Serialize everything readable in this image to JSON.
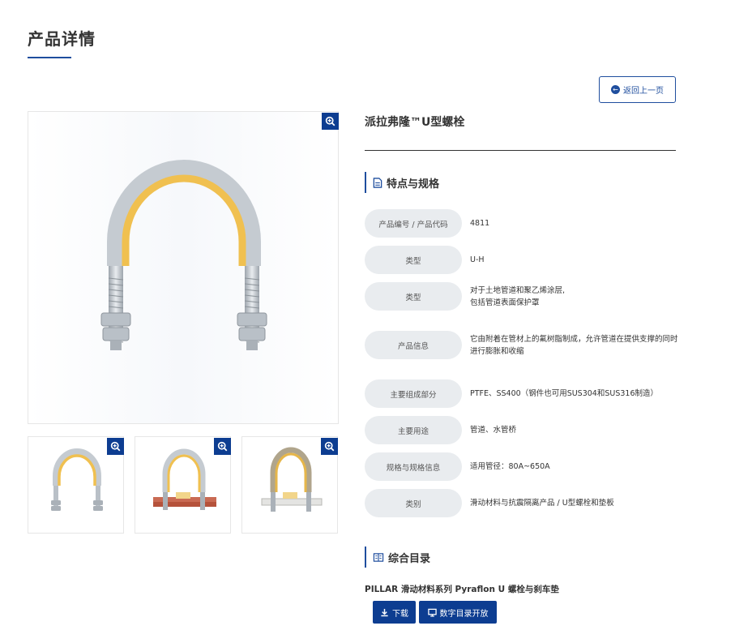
{
  "page": {
    "title": "产品详情"
  },
  "actions": {
    "back_label": "返回上一页"
  },
  "product": {
    "name": "派拉弗隆™U型螺栓"
  },
  "specs_section": {
    "title": "特点与规格"
  },
  "specs": [
    {
      "label": "产品编号 / 产品代码",
      "value": "4811"
    },
    {
      "label": "类型",
      "value": "U-H"
    },
    {
      "label": "类型",
      "value": "对于土地管道和聚乙烯涂层,\n包括管道表面保护罩"
    },
    {
      "label": "产品信息",
      "value": "它由附着在管材上的氟树脂制成，允许管道在提供支撑的同时进行膨胀和收缩"
    },
    {
      "label": "主要组成部分",
      "value": "PTFE、SS400（钢件也可用SUS304和SUS316制造）"
    },
    {
      "label": "主要用途",
      "value": "管道、水管桥"
    },
    {
      "label": "规格与规格信息",
      "value": "适用管径：80A~650A"
    },
    {
      "label": "类别",
      "value": "滑动材料与抗震隔离产品 / U型螺栓和垫板"
    }
  ],
  "catalog_section": {
    "title": "综合目录"
  },
  "catalog": {
    "item_title": "PILLAR 滑动材料系列 Pyraflon U 螺栓与刹车垫",
    "download_label": "下载",
    "digital_label": "数字目录开放"
  },
  "colors": {
    "accent": "#1f4e9e",
    "button": "#0d3d91",
    "coating": "#f2c14e",
    "steel": "#c9ced4",
    "pad": "#b5523b"
  },
  "icons": [
    "zoom-in-icon",
    "arrow-left-icon",
    "document-icon",
    "catalog-book-icon",
    "download-icon",
    "monitor-icon"
  ]
}
